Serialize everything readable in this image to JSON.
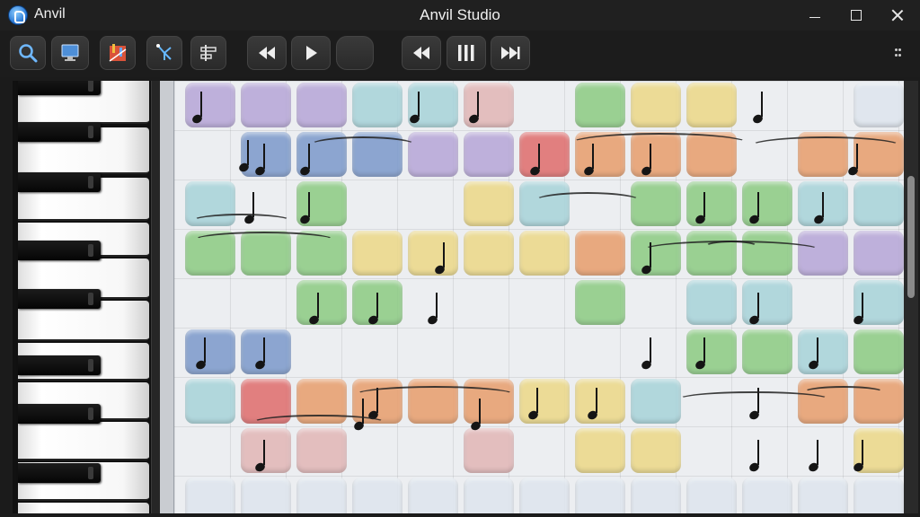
{
  "app": {
    "name": "Anvil",
    "window_title": "Anvil Studio"
  },
  "window_controls": [
    "minimize-icon",
    "maximize-icon",
    "close-icon"
  ],
  "toolbar": {
    "left_tools": [
      "search-icon",
      "monitor-icon",
      "mixer-icon",
      "cursor-branch-icon",
      "align-icon"
    ],
    "transport_1": [
      "rewind-icon",
      "play-icon",
      "blank-button"
    ],
    "transport_2": [
      "skip-back-icon",
      "pause-bars-icon",
      "skip-forward-icon"
    ],
    "overflow": "more-vert-icon"
  },
  "colors": {
    "purple": "#b8a8d8",
    "blue": "#7f9ccc",
    "teal": "#a9d4da",
    "green": "#8fcc86",
    "yellow": "#ecd98a",
    "orange": "#e8a070",
    "red": "#e07070",
    "pink": "#e2b8b8",
    "pale": "#dfe6ee",
    "grid_bg": "#eceef1",
    "accent_blue": "#2a8ad8"
  },
  "piano": {
    "white_keys": 11,
    "black_keys": 8
  }
}
